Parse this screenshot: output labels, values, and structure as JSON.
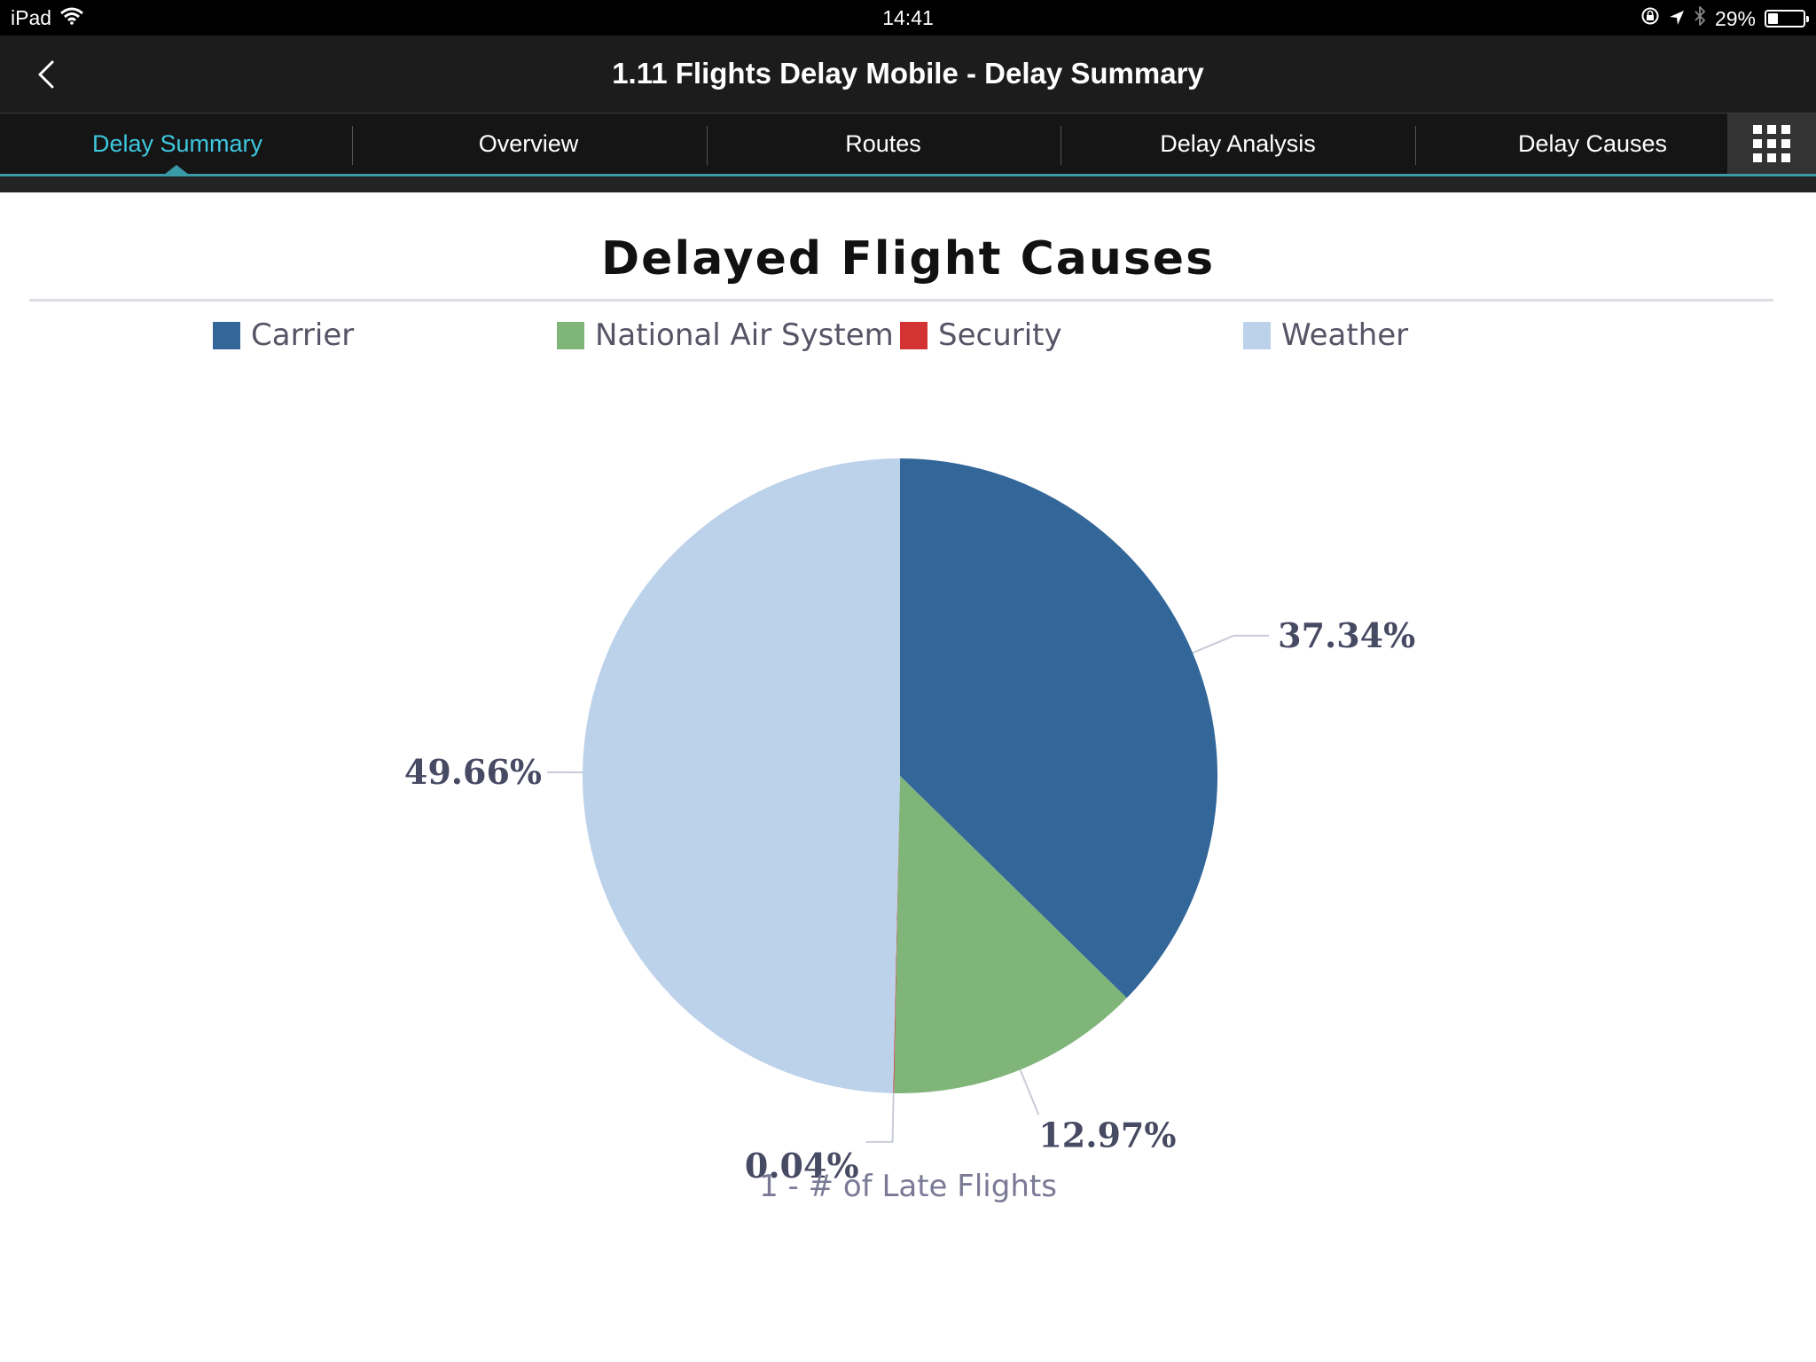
{
  "status_bar": {
    "device": "iPad",
    "time": "14:41",
    "battery": "29%",
    "battery_level": 0.29,
    "icons": [
      "wifi-icon",
      "orientation-lock-icon",
      "location-icon",
      "bluetooth-icon",
      "battery-icon"
    ]
  },
  "header": {
    "title": "1.11 Flights Delay Mobile - Delay Summary",
    "back_icon": "chevron-left-icon"
  },
  "tabs": [
    {
      "label": "Delay Summary",
      "active": true
    },
    {
      "label": "Overview",
      "active": false
    },
    {
      "label": "Routes",
      "active": false
    },
    {
      "label": "Delay Analysis",
      "active": false
    },
    {
      "label": "Delay Causes",
      "active": false
    }
  ],
  "tab_more_icon": "chevron-right-icon",
  "grid_icon": "grid-menu-icon",
  "colors": {
    "accent": "#3ec8e0",
    "carrier": "#336699",
    "national_air_system": "#80b57a",
    "security": "#d43333",
    "weather": "#bcd1ea"
  },
  "chart_data": {
    "type": "pie",
    "title": "Delayed Flight Causes",
    "subtitle": "1 - # of Late Flights",
    "legend_placement": "top",
    "series": [
      {
        "name": "Carrier",
        "value": 37.34,
        "label": "37.34%",
        "color": "#336699"
      },
      {
        "name": "National Air System",
        "value": 12.97,
        "label": "12.97%",
        "color": "#80b57a"
      },
      {
        "name": "Security",
        "value": 0.04,
        "label": "0.04%",
        "color": "#d43333"
      },
      {
        "name": "Weather",
        "value": 49.66,
        "label": "49.66%",
        "color": "#bcd1ea"
      }
    ]
  }
}
